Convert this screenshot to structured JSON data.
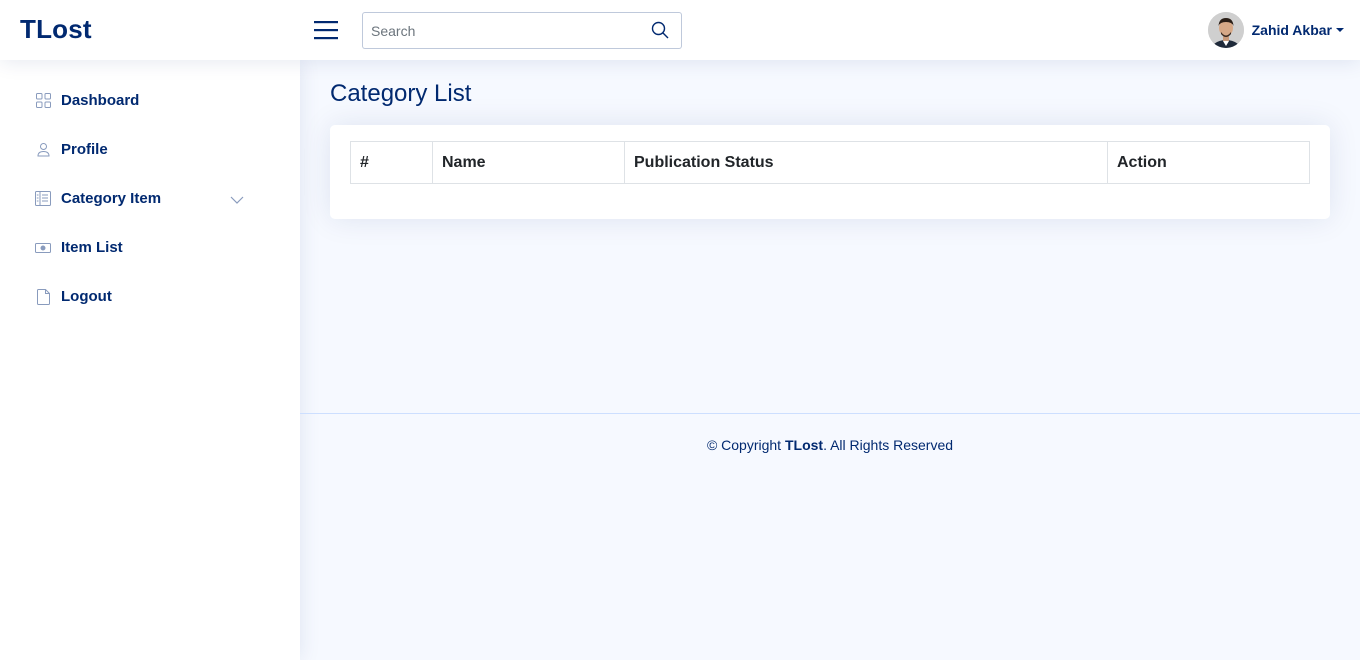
{
  "header": {
    "logo": "TLost",
    "search_placeholder": "Search",
    "user_name": "Zahid Akbar"
  },
  "sidebar": {
    "items": [
      {
        "label": "Dashboard",
        "icon": "grid-icon"
      },
      {
        "label": "Profile",
        "icon": "person-icon"
      },
      {
        "label": "Category Item",
        "icon": "layout-text-sidebar-icon",
        "has_submenu": true
      },
      {
        "label": "Item List",
        "icon": "cash-icon"
      },
      {
        "label": "Logout",
        "icon": "file-icon"
      }
    ]
  },
  "main": {
    "page_title": "Category List",
    "table": {
      "columns": [
        "#",
        "Name",
        "Publication Status",
        "Action"
      ],
      "rows": []
    }
  },
  "footer": {
    "prefix": "© Copyright ",
    "brand": "TLost",
    "suffix": ". All Rights Reserved"
  },
  "colors": {
    "primary": "#012970",
    "background": "#f6f9ff",
    "card": "#ffffff"
  }
}
